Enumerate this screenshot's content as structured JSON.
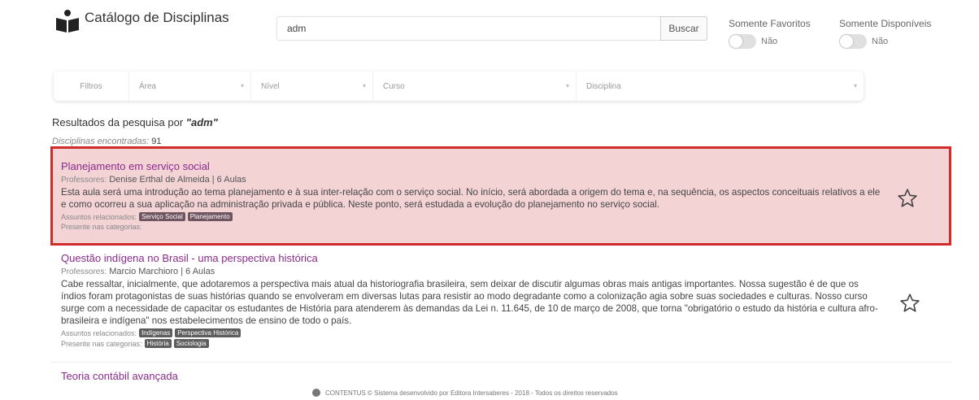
{
  "app": {
    "title": "Catálogo de Disciplinas"
  },
  "search": {
    "value": "adm",
    "button": "Buscar"
  },
  "toggles": [
    {
      "label": "Somente Favoritos",
      "value": "Não"
    },
    {
      "label": "Somente Disponíveis",
      "value": "Não"
    }
  ],
  "filters": {
    "label": "Filtros",
    "selects": [
      {
        "placeholder": "Área"
      },
      {
        "placeholder": "Nível"
      },
      {
        "placeholder": "Curso"
      },
      {
        "placeholder": "Disciplina"
      }
    ]
  },
  "results": {
    "prefix": "Resultados da pesquisa por",
    "query": "\"adm\"",
    "count_label": "Disciplinas encontradas:",
    "count": "91"
  },
  "courses": [
    {
      "title": "Planejamento em serviço social",
      "professors_label": "Professores:",
      "professor": "Denise Erthal de Almeida | 6 Aulas",
      "description": "Esta aula será uma introdução ao tema planejamento e à sua inter-relação com o serviço social. No início, será abordada a origem do tema e, na sequência, os aspectos conceituais relativos a ele e como ocorreu a sua aplicação na administração privada e pública. Neste ponto, será estudada a evolução do planejamento no serviço social.",
      "subjects_label": "Assuntos relacionados:",
      "subjects": [
        "Serviço Social",
        "Planejamento"
      ],
      "categories_label": "Presente nas categorias:",
      "categories": []
    },
    {
      "title": "Questão indígena no Brasil - uma perspectiva histórica",
      "professors_label": "Professores:",
      "professor": "Marcio Marchioro | 6 Aulas",
      "description": "Cabe ressaltar, inicialmente, que adotaremos a perspectiva mais atual da historiografia brasileira, sem deixar de discutir algumas obras mais antigas importantes. Nossa sugestão é de que os índios foram protagonistas de suas histórias quando se envolveram em diversas lutas para resistir ao modo degradante como a colonização agia sobre suas sociedades e culturas. Nosso curso surge com a necessidade de capacitar os estudantes de História para atenderem às demandas da Lei n. 11.645, de 10 de março de 2008, que torna \"obrigatório o estudo da história e cultura afro-brasileira e indígena\" nos estabelecimentos de ensino de todo o país.",
      "subjects_label": "Assuntos relacionados:",
      "subjects": [
        "Indígenas",
        "Perspectiva Histórica"
      ],
      "categories_label": "Presente nas categorias:",
      "categories": [
        "História",
        "Sociologia"
      ]
    },
    {
      "title": "Teoria contábil avançada"
    }
  ],
  "footer": {
    "text": "CONTENTUS © Sistema desenvolvido por Editora Intersaberes - 2018 - Todos os direitos reservados"
  },
  "colors": {
    "accent": "#8a2a8c",
    "highlight_border": "#d12c2c",
    "highlight_bg": "#f4d3d5",
    "tag": "#6e5560"
  }
}
